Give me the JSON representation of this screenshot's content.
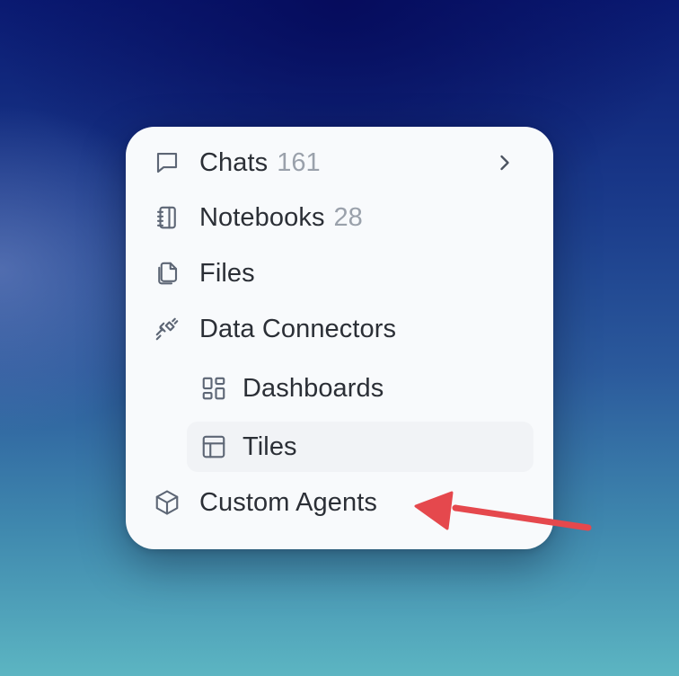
{
  "menu": {
    "items": [
      {
        "label": "Chats",
        "count": "161",
        "icon": "chat-icon",
        "has_submenu": true
      },
      {
        "label": "Notebooks",
        "count": "28",
        "icon": "notebook-icon"
      },
      {
        "label": "Files",
        "icon": "files-icon"
      },
      {
        "label": "Data Connectors",
        "icon": "plug-icon"
      },
      {
        "label": "Dashboards",
        "icon": "dashboard-icon",
        "indent": true
      },
      {
        "label": "Tiles",
        "icon": "tiles-icon",
        "indent": true,
        "active": true
      },
      {
        "label": "Custom Agents",
        "icon": "cube-icon"
      }
    ]
  },
  "annotation": {
    "type": "arrow",
    "color": "#e5484d",
    "points_to": "Custom Agents"
  }
}
